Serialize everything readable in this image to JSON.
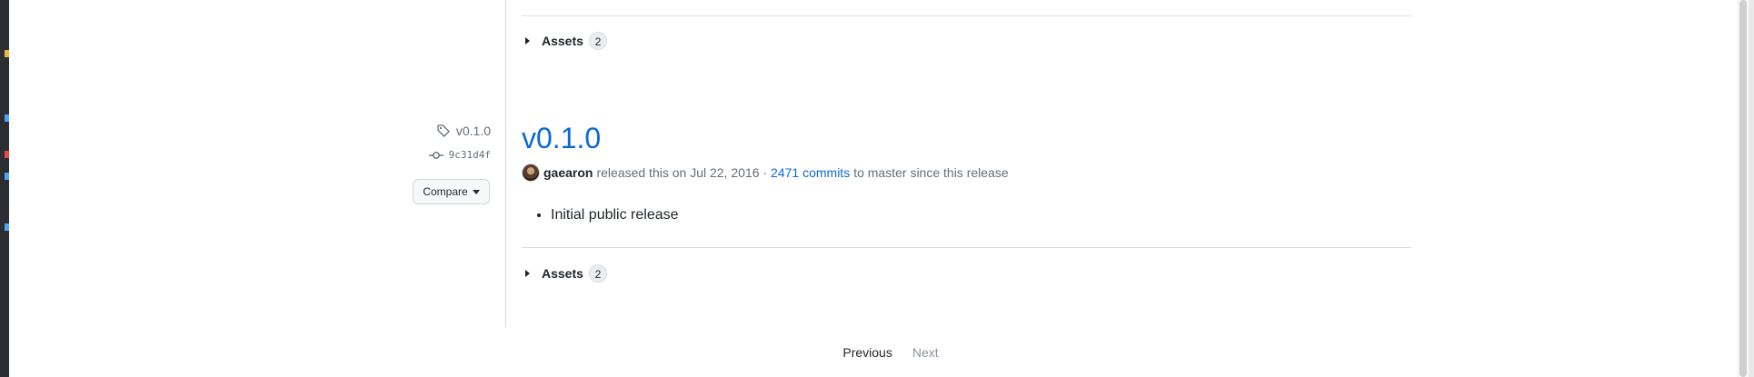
{
  "previous_release": {
    "assets_label": "Assets",
    "assets_count": "2"
  },
  "release": {
    "tag": "v0.1.0",
    "commit": "9c31d4f",
    "compare_label": "Compare",
    "title": "v0.1.0",
    "author": "gaearon",
    "released_text": "released this on Jul 22, 2016 ·",
    "commits_link": "2471 commits",
    "since_text": "to master since this release",
    "notes": [
      "Initial public release"
    ],
    "assets_label": "Assets",
    "assets_count": "2"
  },
  "pagination": {
    "previous": "Previous",
    "next": "Next"
  },
  "colors": {
    "link": "#0969da",
    "muted": "#656d76",
    "text": "#1f2328"
  }
}
